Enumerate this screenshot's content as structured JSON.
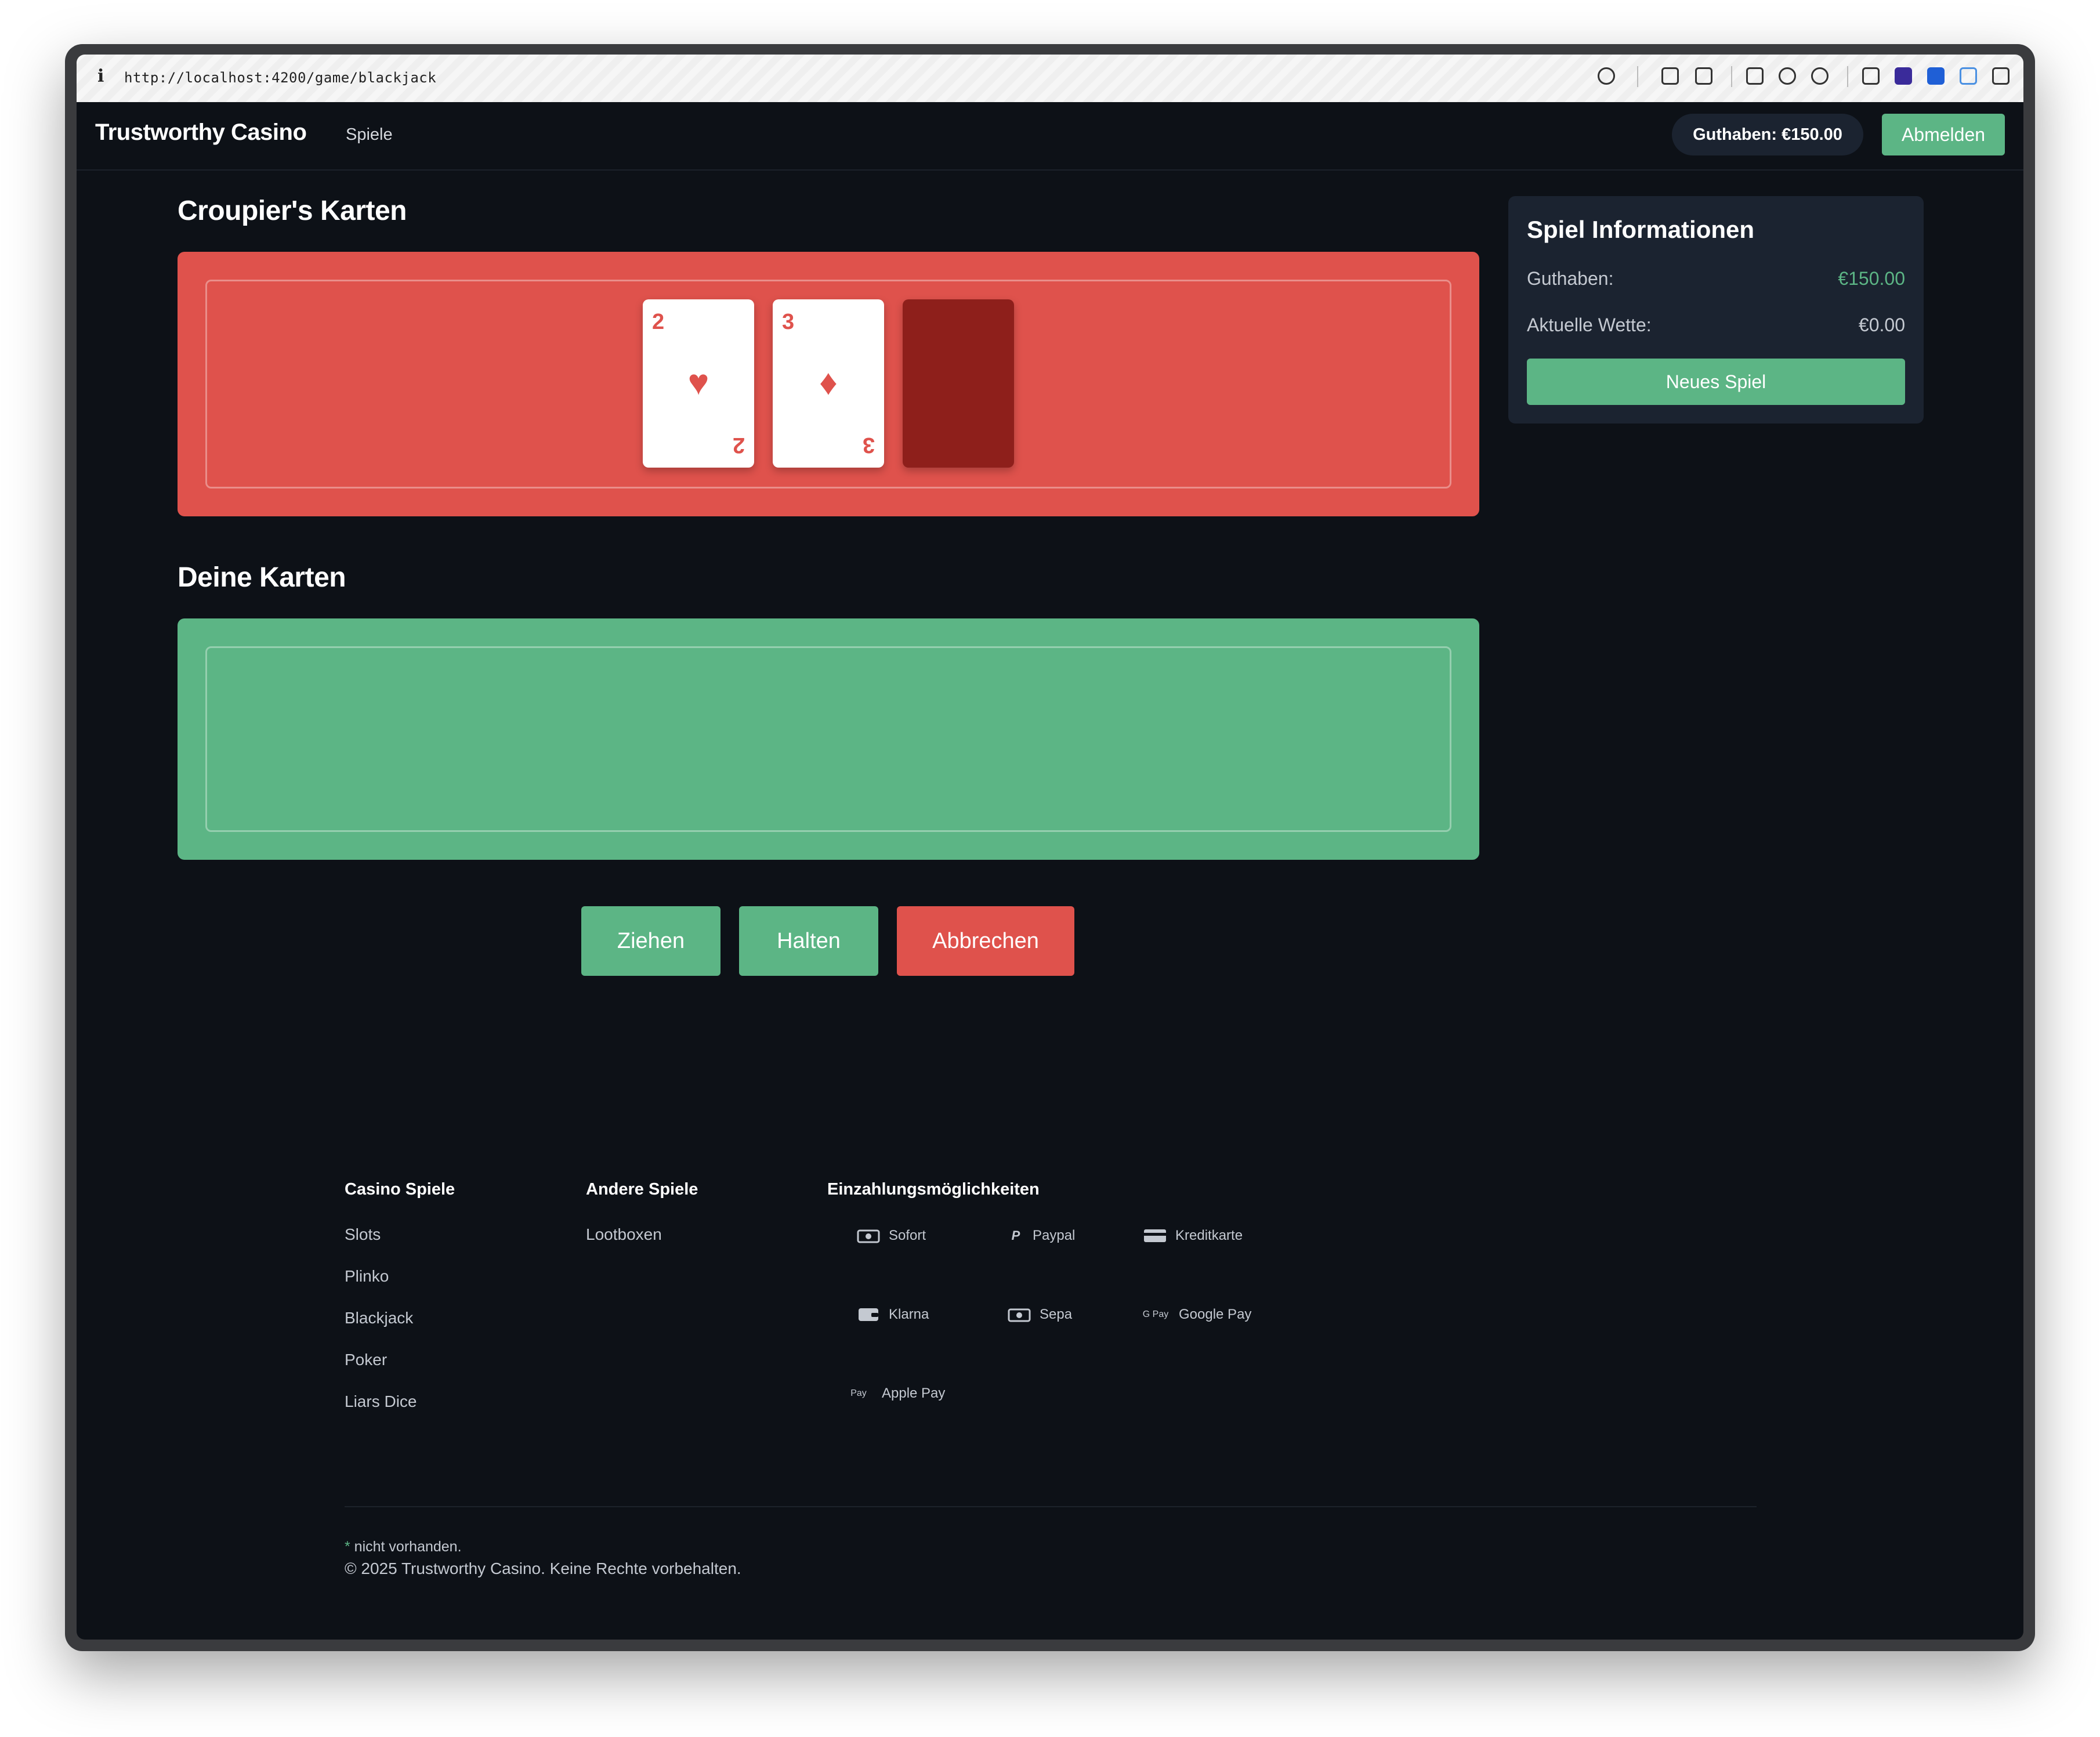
{
  "browser": {
    "url": "http://localhost:4200/game/blackjack",
    "info_icon": "i"
  },
  "nav": {
    "brand": "Trustworthy Casino",
    "link_games": "Spiele",
    "balance": "Guthaben: €150.00",
    "logout": "Abmelden"
  },
  "dealer": {
    "title": "Croupier's Karten",
    "cards": [
      {
        "rank": "2",
        "suit": "♥",
        "suit_icon": "heart-icon"
      },
      {
        "rank": "3",
        "suit": "♦",
        "suit_icon": "diamond-icon"
      }
    ],
    "hidden_card": "card-back"
  },
  "player": {
    "title": "Deine Karten",
    "cards": []
  },
  "actions": {
    "draw": "Ziehen",
    "stand": "Halten",
    "cancel": "Abbrechen"
  },
  "info": {
    "title": "Spiel Informationen",
    "balance_label": "Guthaben:",
    "balance_value": "€150.00",
    "bet_label": "Aktuelle Wette:",
    "bet_value": "€0.00",
    "new_game": "Neues Spiel"
  },
  "footer": {
    "casino_head": "Casino Spiele",
    "casino_links": [
      "Slots",
      "Plinko",
      "Blackjack",
      "Poker",
      "Liars Dice"
    ],
    "other_head": "Andere Spiele",
    "other_links": [
      "Lootboxen"
    ],
    "payment_head": "Einzahlungsmöglichkeiten",
    "payments": [
      {
        "label": "Sofort",
        "icon": "banknote-icon"
      },
      {
        "label": "Paypal",
        "icon": "paypal-icon"
      },
      {
        "label": "Kreditkarte",
        "icon": "credit-card-icon"
      },
      {
        "label": "Klarna",
        "icon": "wallet-icon"
      },
      {
        "label": "Sepa",
        "icon": "banknote-icon"
      },
      {
        "label": "Google Pay",
        "icon": "google-pay-icon",
        "icon_text": "G Pay"
      },
      {
        "label": "Apple Pay",
        "icon": "apple-pay-icon",
        "icon_text": "Pay"
      }
    ],
    "note_star": "*",
    "note": " nicht vorhanden.",
    "copyright": "© 2025 Trustworthy Casino. Keine Rechte vorbehalten."
  },
  "colors": {
    "background": "#0d1117",
    "panel": "#1b2330",
    "green": "#5cb585",
    "red": "#df524c",
    "card_back": "#8e1f1b"
  }
}
